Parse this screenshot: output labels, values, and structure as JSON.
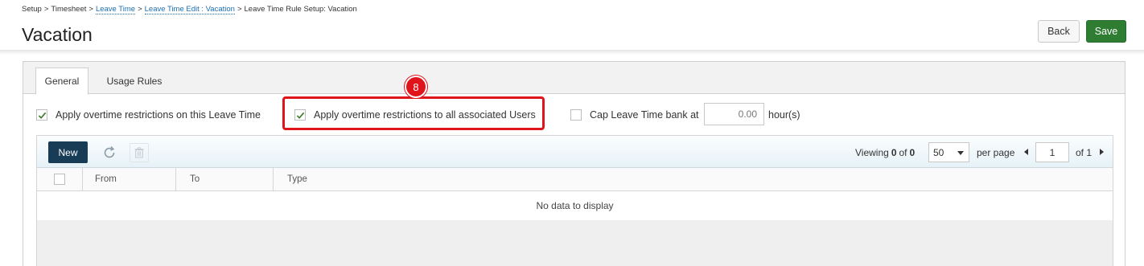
{
  "breadcrumb": {
    "items": [
      {
        "label": "Setup",
        "link": false
      },
      {
        "label": "Timesheet",
        "link": false
      },
      {
        "label": "Leave Time",
        "link": true
      },
      {
        "label": "Leave Time Edit : Vacation",
        "link": true
      },
      {
        "label": "Leave Time Rule Setup: Vacation",
        "link": false
      }
    ],
    "separator": ">"
  },
  "page": {
    "title": "Vacation"
  },
  "actions": {
    "back_label": "Back",
    "save_label": "Save"
  },
  "tabs": [
    {
      "label": "General",
      "active": true
    },
    {
      "label": "Usage Rules",
      "active": false
    }
  ],
  "options": {
    "overtime_leave": {
      "label": "Apply overtime restrictions on this Leave Time",
      "checked": true
    },
    "overtime_users": {
      "label": "Apply overtime restrictions to all associated Users",
      "checked": true
    },
    "cap_bank": {
      "label": "Cap Leave Time bank at",
      "checked": false,
      "value": "0.00",
      "unit": "hour(s)"
    }
  },
  "annotation": {
    "step": "8",
    "color": "#e0141b"
  },
  "grid": {
    "new_label": "New",
    "viewing_label": "Viewing",
    "viewing_from": "0",
    "viewing_of_label": "of",
    "viewing_total": "0",
    "page_size": "50",
    "per_page_label": "per page",
    "page": "1",
    "of_pages": "of 1",
    "columns": [
      "From",
      "To",
      "Type"
    ],
    "empty_message": "No data to display"
  },
  "colors": {
    "primary_dark": "#183b56",
    "save_green": "#2e7d32",
    "link": "#1a6fb3"
  },
  "icons": [
    "refresh-icon",
    "trash-icon",
    "chevron-down-icon",
    "prev-page-icon",
    "next-page-icon",
    "check-icon"
  ]
}
